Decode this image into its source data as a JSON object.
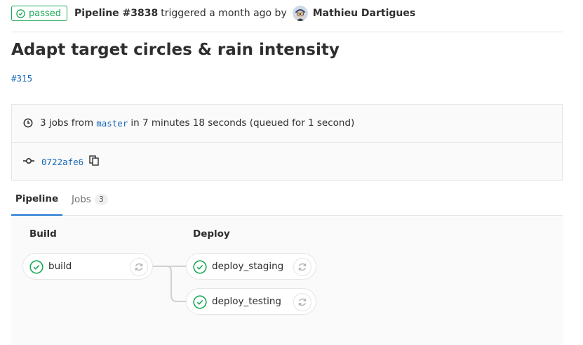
{
  "header": {
    "status_label": "passed",
    "pipeline_id": "Pipeline #3838",
    "trigger_text": "triggered a month ago by",
    "author": "Mathieu Dartigues"
  },
  "title": "Adapt target circles & rain intensity",
  "merge_request": "#315",
  "info": {
    "jobs_text": "3 jobs from",
    "branch": "master",
    "duration_text": "in 7 minutes 18 seconds (queued for 1 second)",
    "commit_sha": "0722afe6"
  },
  "tabs": [
    {
      "label": "Pipeline",
      "active": true
    },
    {
      "label": "Jobs",
      "count": "3",
      "active": false
    }
  ],
  "stages": [
    {
      "name": "Build",
      "jobs": [
        {
          "name": "build",
          "status": "success"
        }
      ]
    },
    {
      "name": "Deploy",
      "jobs": [
        {
          "name": "deploy_staging",
          "status": "success"
        },
        {
          "name": "deploy_testing",
          "status": "success"
        }
      ]
    }
  ],
  "colors": {
    "success": "#1aaa55",
    "link": "#1b69b6",
    "active_tab": "#1f78d1"
  }
}
